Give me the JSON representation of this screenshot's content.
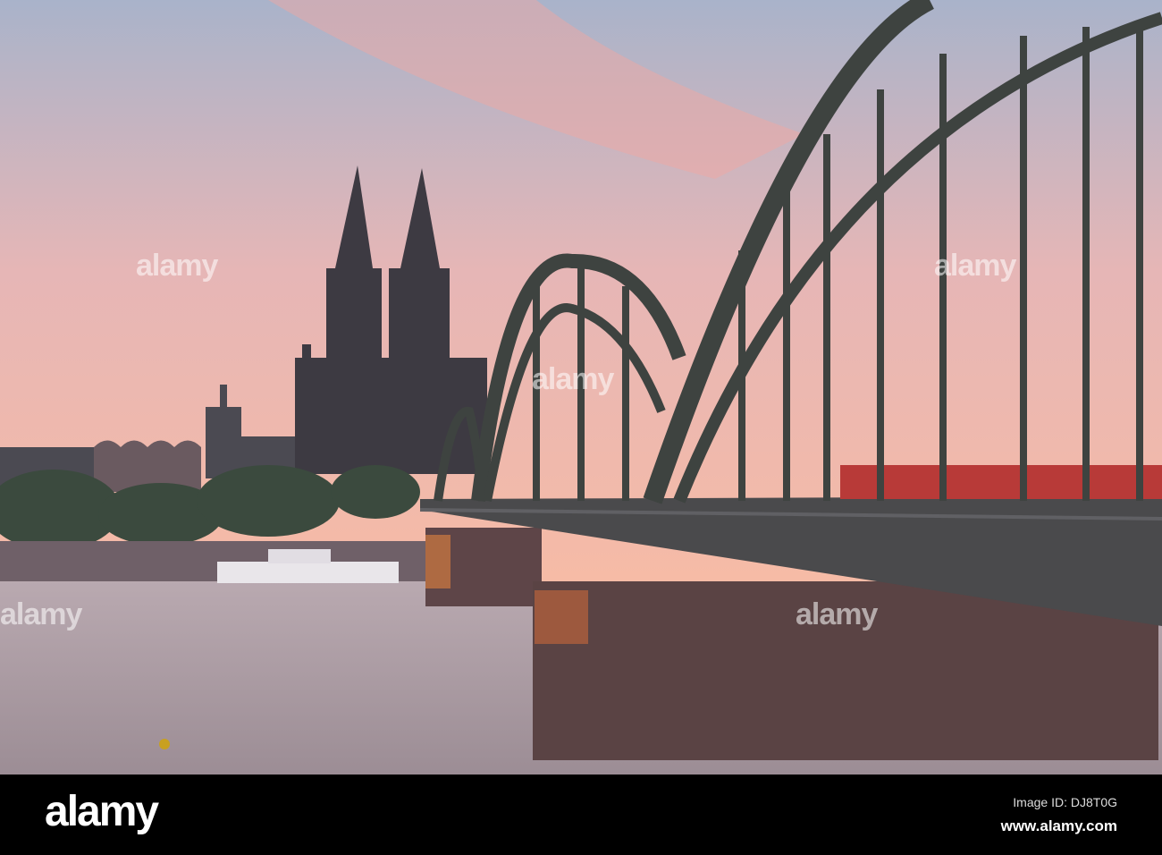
{
  "watermark": "alamy",
  "footer": {
    "logo": "alamy",
    "image_id": "Image ID: DJ8T0G",
    "website": "www.alamy.com"
  },
  "colors": {
    "sky_top": "#aab4cc",
    "sky_bottom": "#f4b9a6",
    "water": "#b8a5a8",
    "bridge": "#3e4340",
    "pier": "#5a4344"
  }
}
